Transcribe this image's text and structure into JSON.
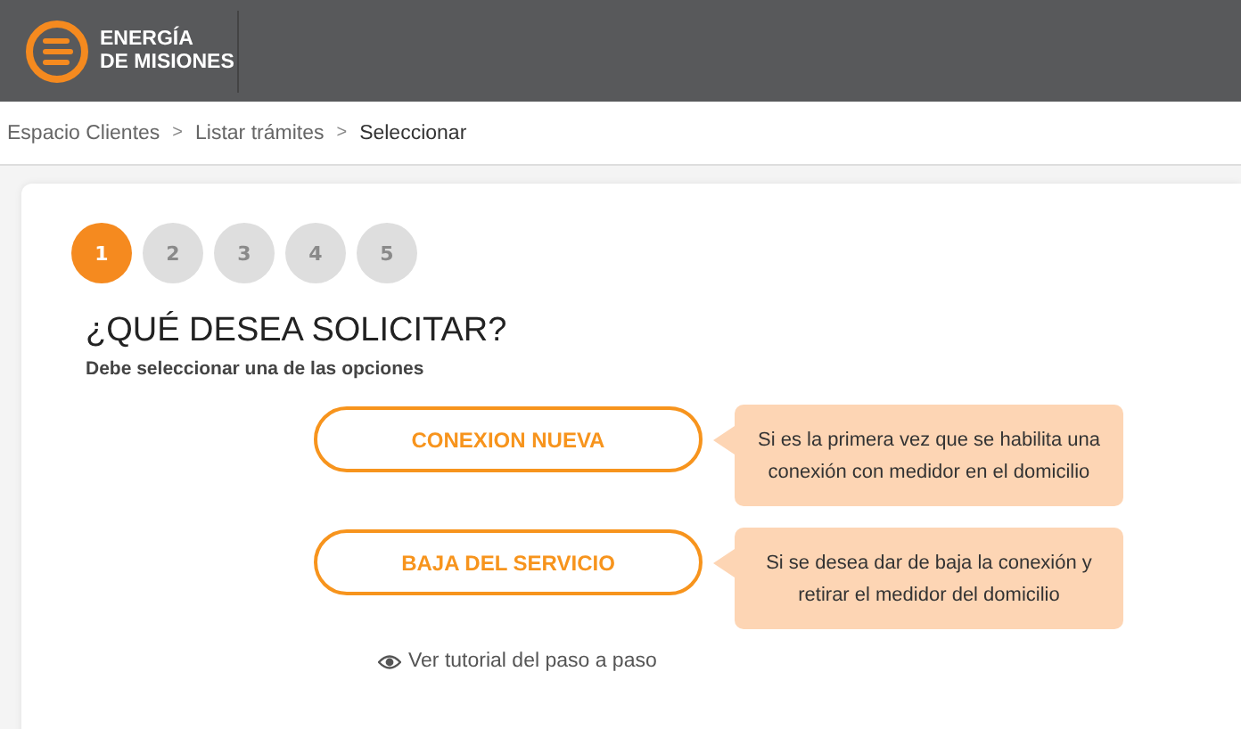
{
  "header": {
    "logo_line_1": "ENERGÍA",
    "logo_line_2": "DE MISIONES"
  },
  "breadcrumb": [
    {
      "label": "Espacio Clientes",
      "current": false
    },
    {
      "label": "Listar trámites",
      "current": false
    },
    {
      "label": "Seleccionar",
      "current": true
    }
  ],
  "breadcrumb_separator": ">",
  "steps": [
    {
      "label": "1",
      "selected": true
    },
    {
      "label": "2",
      "selected": false
    },
    {
      "label": "3",
      "selected": false
    },
    {
      "label": "4",
      "selected": false
    },
    {
      "label": "5",
      "selected": false
    }
  ],
  "title": "¿QUÉ DESEA SOLICITAR?",
  "subtitle": "Debe seleccionar una de las opciones",
  "options": [
    {
      "label": "CONEXION NUEVA",
      "hint": "Si es la primera vez que se habilita una conexión con medidor en el domicilio"
    },
    {
      "label": "BAJA DEL SERVICIO",
      "hint": "Si se desea dar de baja la conexión y retirar el medidor del domicilio"
    }
  ],
  "tutorial_link": "Ver tutorial del paso a paso"
}
